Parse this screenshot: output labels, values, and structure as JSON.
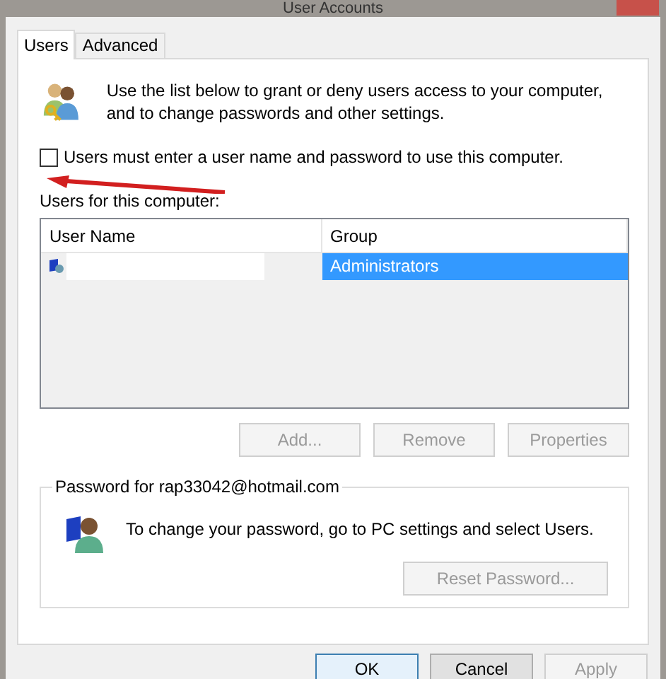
{
  "window": {
    "title": "User Accounts"
  },
  "tabs": [
    {
      "label": "Users",
      "selected": true
    },
    {
      "label": "Advanced",
      "selected": false
    }
  ],
  "intro": "Use the list below to grant or deny users access to your computer, and to change passwords and other settings.",
  "require_login": {
    "label": "Users must enter a user name and password to use this computer.",
    "checked": false
  },
  "users_label": "Users for this computer:",
  "table": {
    "columns": [
      "User Name",
      "Group"
    ],
    "rows": [
      {
        "group": "Administrators",
        "selected": true
      }
    ]
  },
  "list_buttons": [
    {
      "label": "Add...",
      "disabled": true
    },
    {
      "label": "Remove",
      "disabled": true
    },
    {
      "label": "Properties",
      "disabled": true
    }
  ],
  "password_group": {
    "legend": "Password for rap33042@hotmail.com",
    "text": "To change your password, go to PC settings and select Users.",
    "button": {
      "label": "Reset Password...",
      "disabled": true
    }
  },
  "dialog_buttons": [
    {
      "label": "OK",
      "disabled": false,
      "default": true
    },
    {
      "label": "Cancel",
      "disabled": false,
      "default": false
    },
    {
      "label": "Apply",
      "disabled": true,
      "default": false
    }
  ]
}
